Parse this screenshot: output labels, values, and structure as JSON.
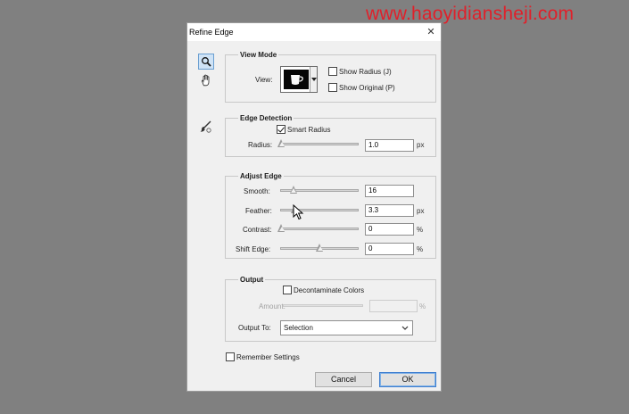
{
  "watermark": "www.haoyidiansheji.com",
  "dialog": {
    "title": "Refine Edge",
    "close_glyph": "✕"
  },
  "tools": [
    {
      "name": "zoom-tool",
      "icon": "magnifier-icon",
      "active": true
    },
    {
      "name": "hand-tool",
      "icon": "hand-icon",
      "active": false
    },
    {
      "name": "refine-radius-tool",
      "icon": "brush-icon",
      "active": false
    }
  ],
  "view_mode": {
    "legend": "View Mode",
    "view_label": "View:",
    "show_radius_label": "Show Radius (J)",
    "show_radius_checked": false,
    "show_original_label": "Show Original (P)",
    "show_original_checked": false
  },
  "edge_detection": {
    "legend": "Edge Detection",
    "smart_radius_label": "Smart Radius",
    "smart_radius_checked": true,
    "radius_label": "Radius:",
    "radius_value": "1.0",
    "radius_unit": "px",
    "radius_slider": 0.0
  },
  "adjust_edge": {
    "legend": "Adjust Edge",
    "smooth_label": "Smooth:",
    "smooth_value": "16",
    "smooth_slider": 0.16,
    "feather_label": "Feather:",
    "feather_value": "3.3",
    "feather_unit": "px",
    "feather_slider": 0.18,
    "contrast_label": "Contrast:",
    "contrast_value": "0",
    "contrast_unit": "%",
    "contrast_slider": 0.0,
    "shift_edge_label": "Shift Edge:",
    "shift_edge_value": "0",
    "shift_edge_unit": "%",
    "shift_edge_slider": 0.5
  },
  "output": {
    "legend": "Output",
    "decontaminate_label": "Decontaminate Colors",
    "decontaminate_checked": false,
    "amount_label": "Amount:",
    "amount_value": "",
    "amount_unit": "%",
    "output_to_label": "Output To:",
    "output_to_value": "Selection"
  },
  "remember_settings_label": "Remember Settings",
  "remember_settings_checked": false,
  "buttons": {
    "cancel": "Cancel",
    "ok": "OK"
  }
}
